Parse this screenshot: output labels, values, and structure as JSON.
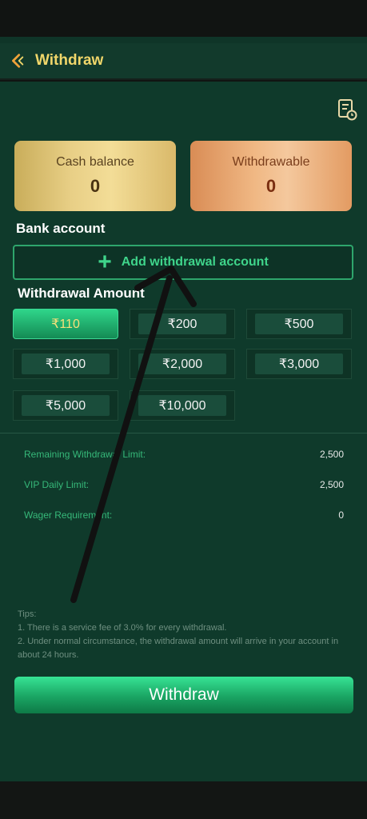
{
  "header": {
    "title": "Withdraw"
  },
  "balances": {
    "cash": {
      "label": "Cash balance",
      "value": "0"
    },
    "withdrawable": {
      "label": "Withdrawable",
      "value": "0"
    }
  },
  "bank": {
    "title": "Bank account",
    "add_label": "Add withdrawal account"
  },
  "amount": {
    "title": "Withdrawal Amount",
    "options": [
      "₹110",
      "₹200",
      "₹500",
      "₹1,000",
      "₹2,000",
      "₹3,000",
      "₹5,000",
      "₹10,000"
    ],
    "selected": "₹110"
  },
  "limits": [
    {
      "label": "Remaining Withdrawal Limit:",
      "value": "2,500"
    },
    {
      "label": "VIP Daily Limit:",
      "value": "2,500"
    },
    {
      "label": "Wager Requirement:",
      "value": "0"
    }
  ],
  "tips": {
    "heading": "Tips:",
    "lines": [
      "1. There is a service fee of 3.0% for every withdrawal.",
      "2. Under normal circumstance, the withdrawal amount will arrive in your account in about 24 hours."
    ]
  },
  "withdraw_button": "Withdraw",
  "colors": {
    "accent": "#2ea66c",
    "title_gold": "#f0d66a",
    "background": "#0f3a2b"
  }
}
